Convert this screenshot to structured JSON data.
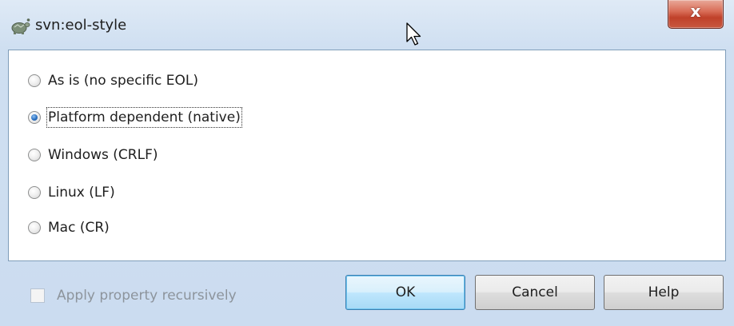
{
  "window": {
    "title": "svn:eol-style",
    "close_glyph": "x"
  },
  "options": [
    {
      "label": "As is (no specific EOL)",
      "checked": false
    },
    {
      "label": "Platform dependent (native)",
      "checked": true
    },
    {
      "label": "Windows (CRLF)",
      "checked": false
    },
    {
      "label": "Linux (LF)",
      "checked": false
    },
    {
      "label": "Mac (CR)",
      "checked": false
    }
  ],
  "footer": {
    "recursive_label": "Apply property recursively",
    "recursive_checked": false,
    "recursive_enabled": false,
    "ok_label": "OK",
    "cancel_label": "Cancel",
    "help_label": "Help"
  },
  "icons": {
    "app": "tortoise-icon",
    "close": "close-icon",
    "cursor": "mouse-pointer-icon"
  },
  "colors": {
    "title_bar": "#d4e3f3",
    "close_button": "#c8503a",
    "default_button": "#bee6fd",
    "disabled_text": "#8d949c"
  }
}
